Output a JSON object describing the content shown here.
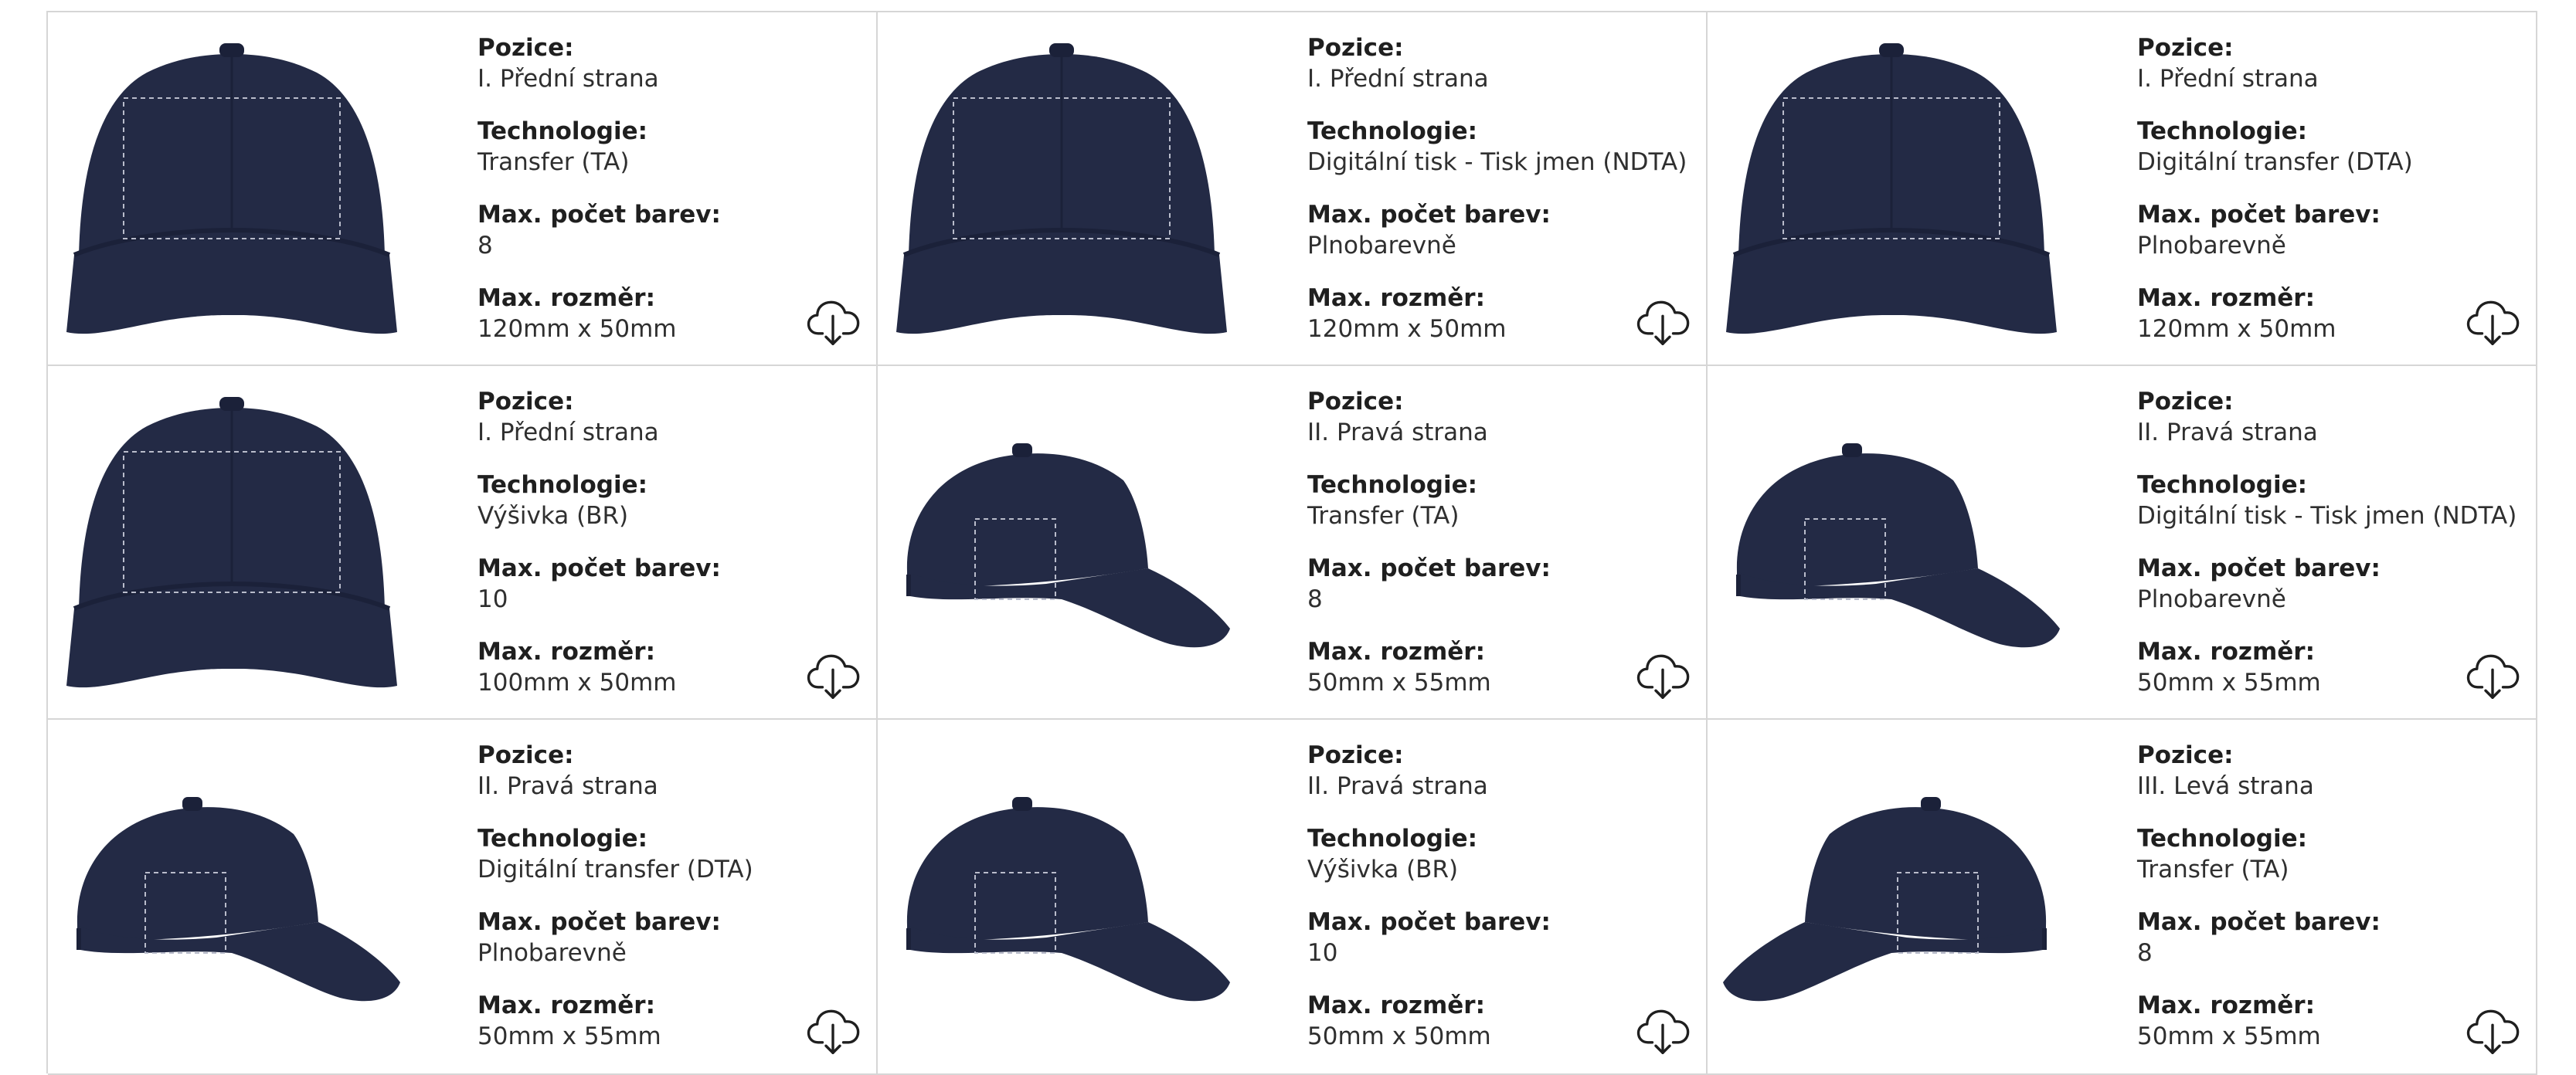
{
  "labels": {
    "position": "Pozice:",
    "technology": "Technologie:",
    "max_colors": "Max. počet barev:",
    "max_size": "Max. rozměr:"
  },
  "cards": [
    {
      "view": "front",
      "position": "I. Přední strana",
      "technology": "Transfer (TA)",
      "max_colors": "8",
      "max_size": "120mm x 50mm"
    },
    {
      "view": "front",
      "position": "I. Přední strana",
      "technology": "Digitální tisk - Tisk jmen (NDTA)",
      "max_colors": "Plnobarevně",
      "max_size": "120mm x 50mm"
    },
    {
      "view": "front",
      "position": "I. Přední strana",
      "technology": "Digitální transfer (DTA)",
      "max_colors": "Plnobarevně",
      "max_size": "120mm x 50mm"
    },
    {
      "view": "front",
      "position": "I. Přední strana",
      "technology": "Výšivka (BR)",
      "max_colors": "10",
      "max_size": "100mm x 50mm"
    },
    {
      "view": "right",
      "position": "II. Pravá strana",
      "technology": "Transfer (TA)",
      "max_colors": "8",
      "max_size": "50mm x 55mm"
    },
    {
      "view": "right",
      "position": "II. Pravá strana",
      "technology": "Digitální tisk - Tisk jmen (NDTA)",
      "max_colors": "Plnobarevně",
      "max_size": "50mm x 55mm"
    },
    {
      "view": "right",
      "position": "II. Pravá strana",
      "technology": "Digitální transfer (DTA)",
      "max_colors": "Plnobarevně",
      "max_size": "50mm x 55mm"
    },
    {
      "view": "right",
      "position": "II. Pravá strana",
      "technology": "Výšivka (BR)",
      "max_colors": "10",
      "max_size": "50mm x 50mm"
    },
    {
      "view": "left",
      "position": "III. Levá strana",
      "technology": "Transfer (TA)",
      "max_colors": "8",
      "max_size": "50mm x 55mm"
    }
  ],
  "colors": {
    "cap": "#232a45",
    "cap_shade": "#1b2139",
    "border": "#d6d6d6"
  },
  "icons": {
    "download": "cloud-download-icon"
  }
}
